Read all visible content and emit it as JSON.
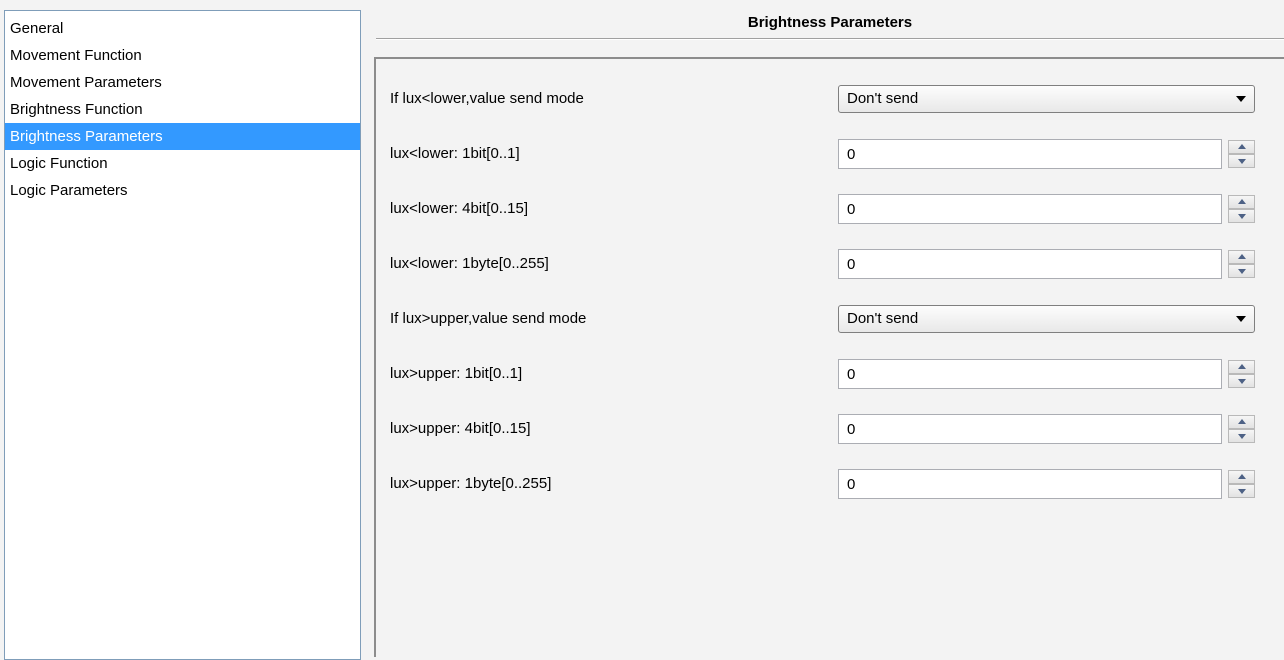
{
  "nav": {
    "items": [
      {
        "label": "General"
      },
      {
        "label": "Movement Function"
      },
      {
        "label": "Movement Parameters"
      },
      {
        "label": "Brightness Function"
      },
      {
        "label": "Brightness Parameters",
        "selected": true
      },
      {
        "label": "Logic Function"
      },
      {
        "label": "Logic Parameters"
      }
    ]
  },
  "page": {
    "title": "Brightness Parameters"
  },
  "params": [
    {
      "label": "If lux<lower,value send mode",
      "type": "select",
      "value": "Don't send"
    },
    {
      "label": "lux<lower: 1bit[0..1]",
      "type": "number",
      "value": "0"
    },
    {
      "label": "lux<lower: 4bit[0..15]",
      "type": "number",
      "value": "0"
    },
    {
      "label": "lux<lower: 1byte[0..255]",
      "type": "number",
      "value": "0"
    },
    {
      "label": "If lux>upper,value send mode",
      "type": "select",
      "value": "Don't send"
    },
    {
      "label": "lux>upper: 1bit[0..1]",
      "type": "number",
      "value": "0"
    },
    {
      "label": "lux>upper: 4bit[0..15]",
      "type": "number",
      "value": "0"
    },
    {
      "label": "lux>upper: 1byte[0..255]",
      "type": "number",
      "value": "0"
    }
  ],
  "icons": {
    "select_arrow": "chevron-down-icon",
    "spin_up": "arrow-up-icon",
    "spin_down": "arrow-down-icon"
  },
  "colors": {
    "selection": "#3399ff",
    "window_bg": "#f3f3f3"
  }
}
